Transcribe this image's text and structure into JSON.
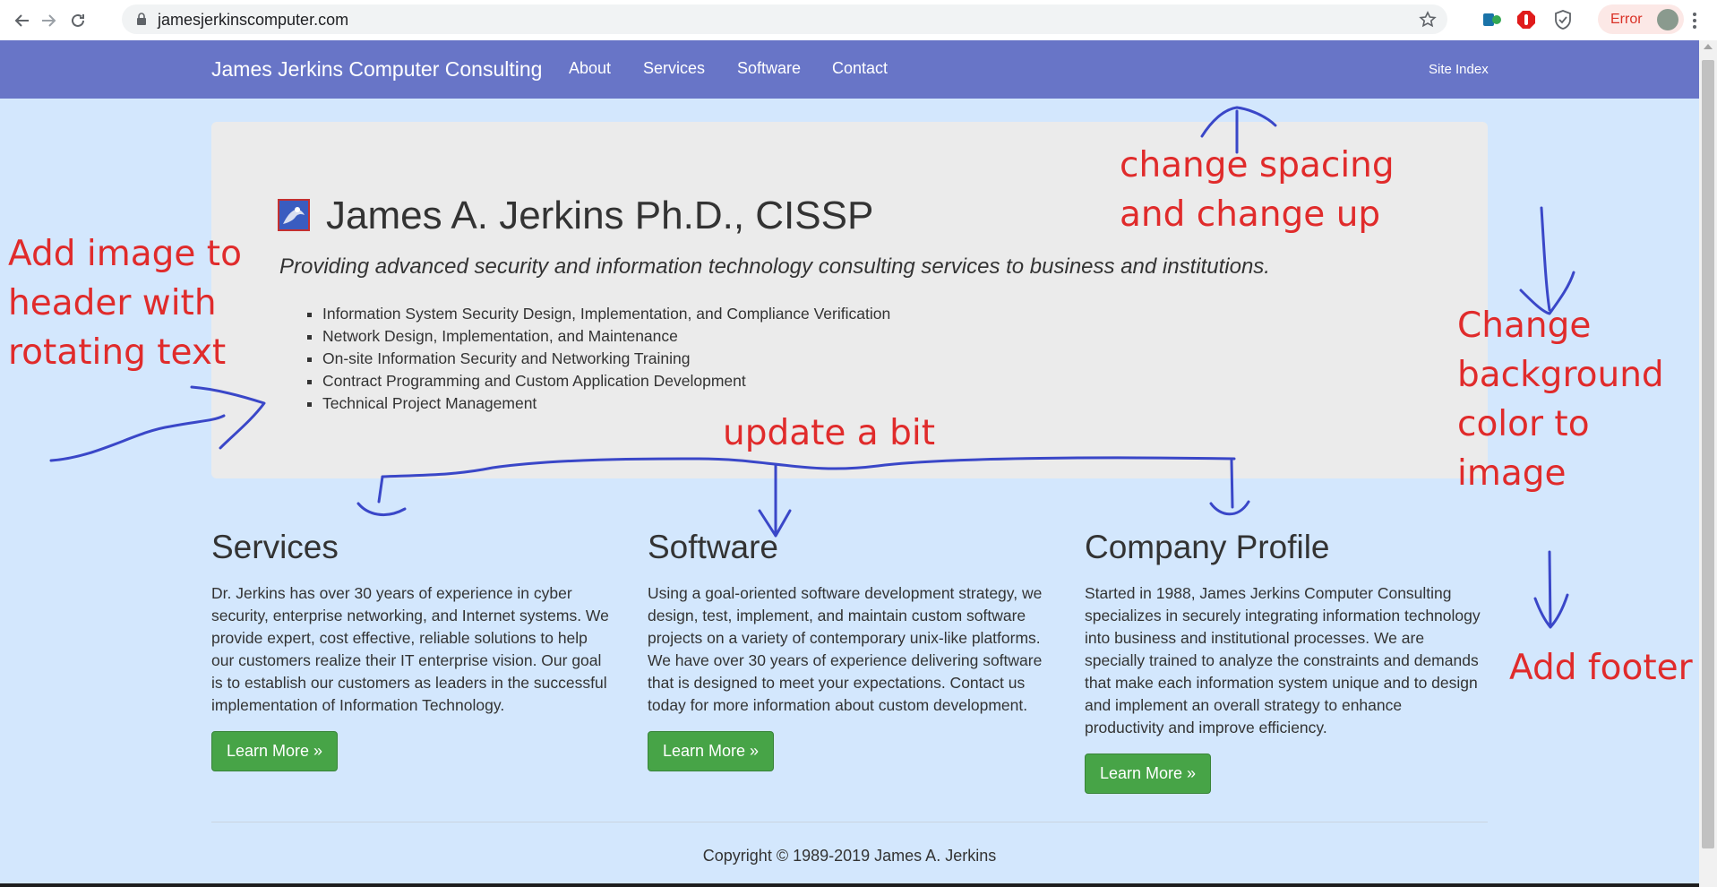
{
  "browser": {
    "url": "jamesjerkinscomputer.com",
    "error_label": "Error",
    "icons": [
      "back-arrow-icon",
      "forward-arrow-icon",
      "reload-icon",
      "lock-icon",
      "star-icon",
      "extension-icon",
      "stop-sign-icon",
      "shield-icon",
      "avatar-icon",
      "menu-icon"
    ]
  },
  "navbar": {
    "brand": "James Jerkins Computer Consulting",
    "links": [
      "About",
      "Services",
      "Software",
      "Contact"
    ],
    "site_index": "Site Index",
    "color": "#6875c7"
  },
  "hero": {
    "title": "James A. Jerkins Ph.D., CISSP",
    "subtitle": "Providing advanced security and information technology consulting services to business and institutions.",
    "items": [
      "Information System Security Design, Implementation, and Compliance Verification",
      "Network Design, Implementation, and Maintenance",
      "On-site Information Security and Networking Training",
      "Contract Programming and Custom Application Development",
      "Technical Project Management"
    ]
  },
  "columns": [
    {
      "heading": "Services",
      "text": "Dr. Jerkins has over 30 years of experience in cyber security, enterprise networking, and Internet systems. We provide expert, cost effective, reliable solutions to help our customers realize their IT enterprise vision. Our goal is to establish our customers as leaders in the successful implementation of Information Technology.",
      "button": "Learn More »"
    },
    {
      "heading": "Software",
      "text": "Using a goal-oriented software development strategy, we design, test, implement, and maintain custom software projects on a variety of contemporary unix-like platforms. We have over 30 years of experience delivering software that is designed to meet your expectations. Contact us today for more information about custom development.",
      "button": "Learn More »"
    },
    {
      "heading": "Company Profile",
      "text": "Started in 1988, James Jerkins Computer Consulting specializes in securely integrating information technology into business and institutional processes. We are specially trained to analyze the constraints and demands that make each information system unique and to design and implement an overall strategy to enhance productivity and improve efficiency.",
      "button": "Learn More »"
    }
  ],
  "footer": {
    "copyright": "Copyright © 1989-2019 James A. Jerkins"
  },
  "annotations": {
    "spacing": [
      "change spacing",
      "and change up"
    ],
    "header_image": [
      "Add image to",
      "header with",
      "rotating text"
    ],
    "update": "update a bit",
    "background": [
      "Change",
      "background",
      "color to",
      "image"
    ],
    "footer": "Add footer",
    "ink_color": "#e02b2b",
    "pen_color": "#3a47c8"
  },
  "colors": {
    "page_background": "#d3e7fd",
    "jumbotron": "#ebebeb",
    "button": "#47a447"
  }
}
